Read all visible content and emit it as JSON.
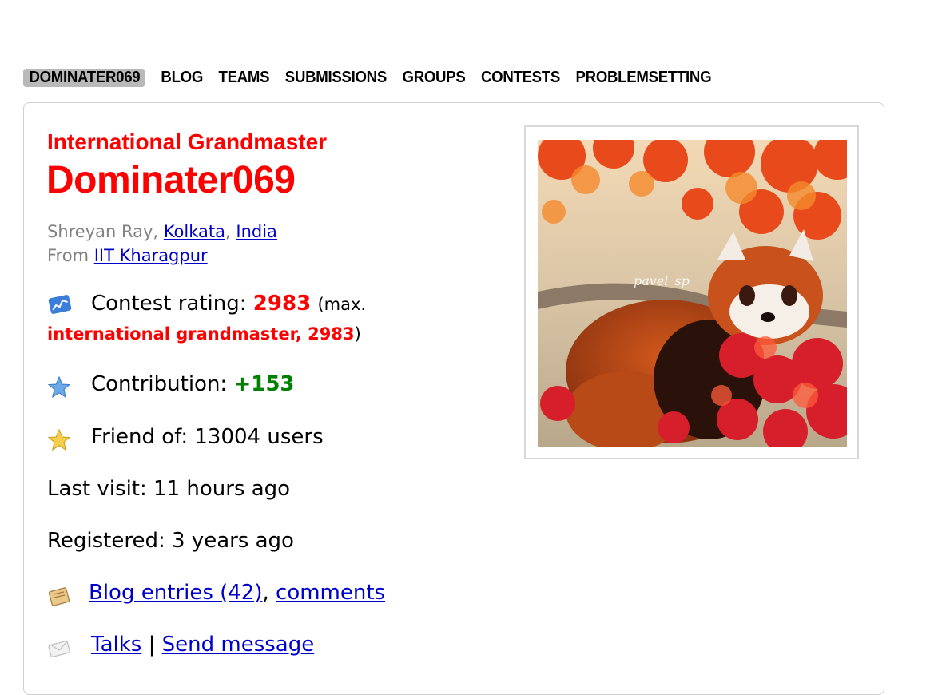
{
  "nav": {
    "tabs": [
      {
        "label": "DOMINATER069",
        "active": true
      },
      {
        "label": "BLOG"
      },
      {
        "label": "TEAMS"
      },
      {
        "label": "SUBMISSIONS"
      },
      {
        "label": "GROUPS"
      },
      {
        "label": "CONTESTS"
      },
      {
        "label": "PROBLEMSETTING"
      }
    ]
  },
  "profile": {
    "rank": "International Grandmaster",
    "handle": "Dominater069",
    "name": "Shreyan Ray",
    "sep1": ",",
    "city": "Kolkata",
    "sep2": ",",
    "country": "India",
    "from_prefix": "From",
    "organization": "IIT Kharagpur",
    "rating_label": "Contest rating:",
    "rating_value": "2983",
    "max_open": "(max.",
    "max_rank": "international grandmaster, 2983",
    "max_close": ")",
    "contribution_label": "Contribution:",
    "contribution_value": "+153",
    "friend_of": "Friend of: 13004 users",
    "last_visit": "Last visit: 11 hours ago",
    "registered": "Registered: 3 years ago",
    "blog_entries": "Blog entries (42)",
    "comma": ",",
    "comments": "comments",
    "talks": "Talks",
    "pipe": "|",
    "send_message": "Send message",
    "photo_watermark": "pavel_sp"
  },
  "colors": {
    "rank_red": "#ff0000",
    "link_blue": "#0000cc",
    "contribution_green": "#008000",
    "tab_active_bg": "#b9b9b9"
  },
  "icons": [
    "rating-chart-icon",
    "star-blue-icon",
    "star-gold-icon",
    "blog-icon",
    "envelope-icon"
  ]
}
